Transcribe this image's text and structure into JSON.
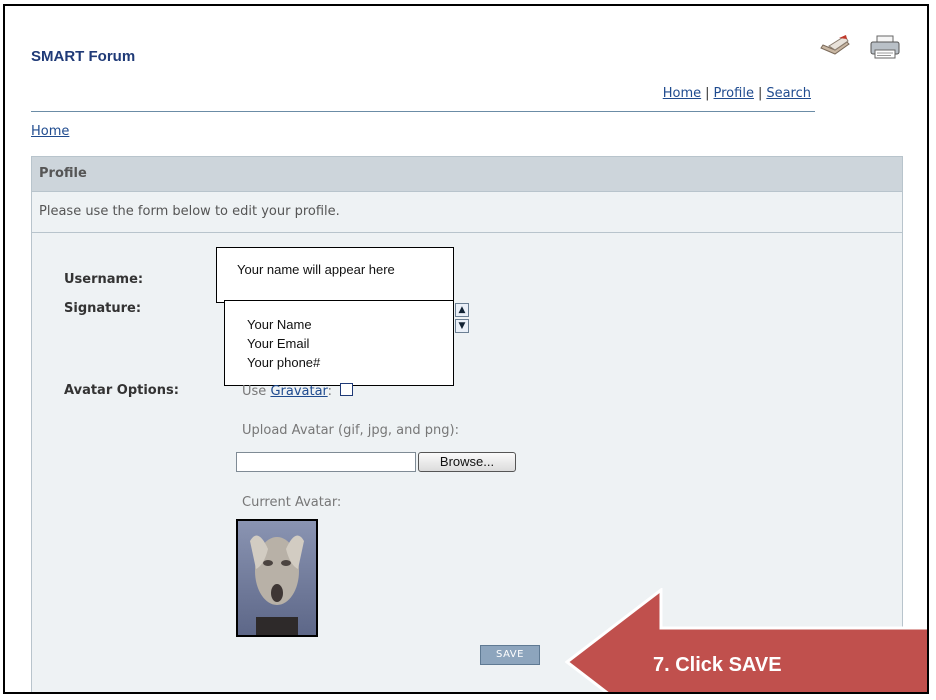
{
  "site": {
    "title": "SMART Forum"
  },
  "topnav": {
    "home": "Home",
    "profile": "Profile",
    "search": "Search",
    "separator": "|"
  },
  "breadcrumb": {
    "home": "Home"
  },
  "panel": {
    "title": "Profile",
    "subtitle": "Please use the form below to edit your profile."
  },
  "form": {
    "username_label": "Username:",
    "signature_label": "Signature:",
    "avatar_options_label": "Avatar Options:",
    "use_prefix": "Use",
    "gravatar_link": "Gravatar",
    "gravatar_suffix": ":",
    "upload_label": "Upload Avatar (gif, jpg, and png):",
    "browse_label": "Browse...",
    "current_avatar_label": "Current Avatar:",
    "save_label": "SAVE"
  },
  "callouts": {
    "username_note": "Your name will appear here",
    "signature_lines": [
      "Your Name",
      "Your Email",
      "Your phone#"
    ]
  },
  "annotation": {
    "instruction": "7. Click SAVE",
    "color": "#c0504d"
  },
  "icons": {
    "email": "email-icon",
    "print": "print-icon",
    "scroll_up": "chevron-up-icon",
    "scroll_down": "chevron-down-icon"
  }
}
